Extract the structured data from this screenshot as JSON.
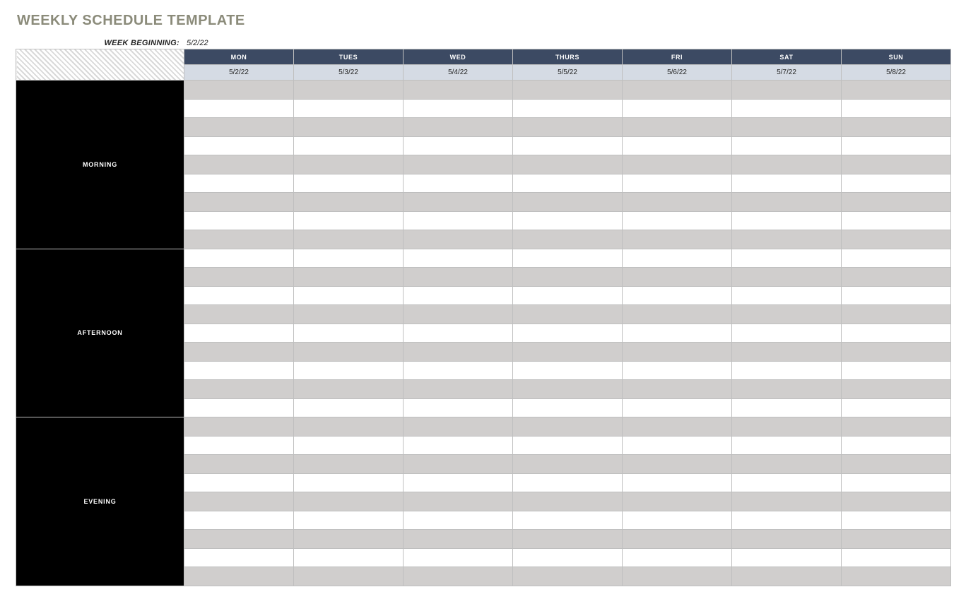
{
  "title": "WEEKLY SCHEDULE TEMPLATE",
  "week_beginning_label": "WEEK BEGINNING:",
  "week_beginning_value": "5/2/22",
  "days": [
    {
      "name": "MON",
      "date": "5/2/22"
    },
    {
      "name": "TUES",
      "date": "5/3/22"
    },
    {
      "name": "WED",
      "date": "5/4/22"
    },
    {
      "name": "THURS",
      "date": "5/5/22"
    },
    {
      "name": "FRI",
      "date": "5/6/22"
    },
    {
      "name": "SAT",
      "date": "5/7/22"
    },
    {
      "name": "SUN",
      "date": "5/8/22"
    }
  ],
  "periods": [
    {
      "label": "MORNING",
      "rows": 9
    },
    {
      "label": "AFTERNOON",
      "rows": 9
    },
    {
      "label": "EVENING",
      "rows": 9
    }
  ],
  "colors": {
    "title": "#8b8b7a",
    "day_header_bg": "#3c4a63",
    "date_row_bg": "#d5dbe4",
    "period_bg": "#000000",
    "row_shade": "#d0cecd",
    "border": "#bfbfbf"
  }
}
